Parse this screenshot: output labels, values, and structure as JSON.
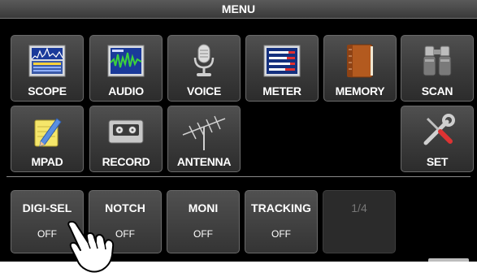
{
  "menu": {
    "title": "MENU"
  },
  "row1": [
    {
      "label": "SCOPE",
      "icon": "scope-icon"
    },
    {
      "label": "AUDIO",
      "icon": "audio-icon"
    },
    {
      "label": "VOICE",
      "icon": "microphone-icon"
    },
    {
      "label": "METER",
      "icon": "meter-icon"
    },
    {
      "label": "MEMORY",
      "icon": "memory-book-icon"
    },
    {
      "label": "SCAN",
      "icon": "binoculars-icon"
    }
  ],
  "row2": [
    {
      "label": "MPAD",
      "icon": "notepad-pencil-icon"
    },
    {
      "label": "RECORD",
      "icon": "cassette-icon"
    },
    {
      "label": "ANTENNA",
      "icon": "antenna-icon"
    },
    {
      "label": "SET",
      "icon": "wrench-screwdriver-icon"
    }
  ],
  "functions": [
    {
      "label": "DIGI-SEL",
      "state": "OFF"
    },
    {
      "label": "NOTCH",
      "state": "OFF"
    },
    {
      "label": "MONI",
      "state": "OFF"
    },
    {
      "label": "TRACKING",
      "state": "OFF"
    },
    {
      "label": "1/4",
      "state": ""
    }
  ],
  "colors": {
    "screen": "#000000",
    "tile": "#3f3f3f",
    "text": "#ffffff",
    "disabled_text": "#777777"
  },
  "pointer": {
    "icon": "tapping-hand-icon"
  }
}
